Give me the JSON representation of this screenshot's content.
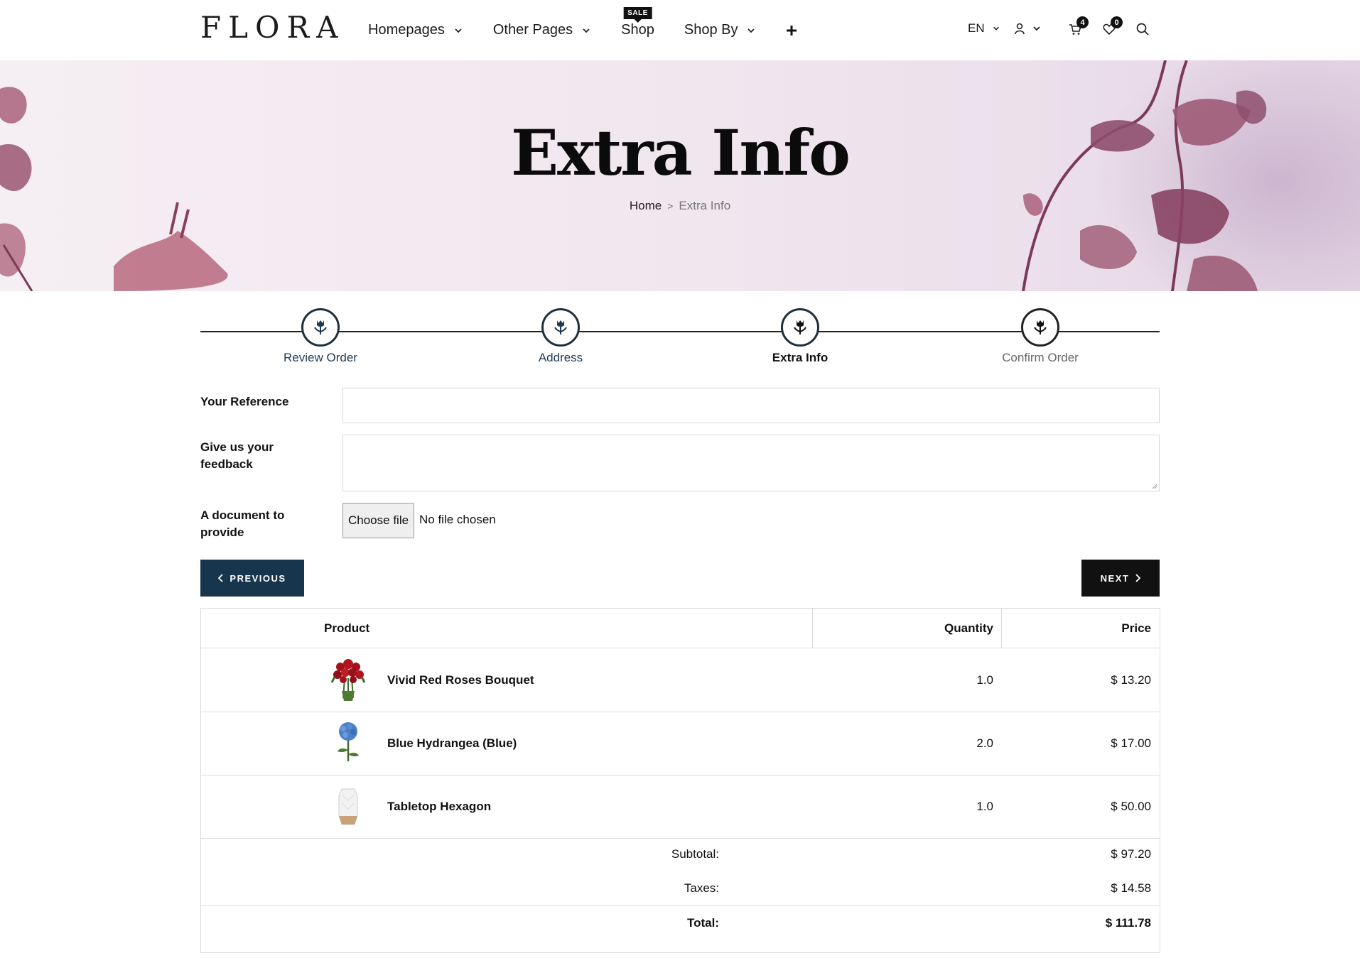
{
  "header": {
    "logo": "FLORA",
    "nav": [
      {
        "label": "Homepages",
        "has_dropdown": true
      },
      {
        "label": "Other Pages",
        "has_dropdown": true
      },
      {
        "label": "Shop",
        "badge": "SALE",
        "has_dropdown": false
      },
      {
        "label": "Shop By",
        "has_dropdown": true
      }
    ],
    "plus_icon": "plus-icon",
    "language": "EN",
    "cart_count": "4",
    "wishlist_count": "0",
    "icons": [
      "user-icon",
      "cart-icon",
      "heart-icon",
      "search-icon"
    ]
  },
  "banner": {
    "title": "Extra Info",
    "breadcrumb": {
      "home": "Home",
      "separator": ">",
      "current": "Extra Info"
    }
  },
  "steps": [
    {
      "label": "Review Order",
      "state": "done",
      "icon": "tulip-icon"
    },
    {
      "label": "Address",
      "state": "done",
      "icon": "tulip-icon"
    },
    {
      "label": "Extra Info",
      "state": "active",
      "icon": "tulip-icon"
    },
    {
      "label": "Confirm Order",
      "state": "future",
      "icon": "tulip-icon"
    }
  ],
  "form": {
    "reference_label": "Your Reference",
    "reference_value": "",
    "feedback_label": "Give us your feedback",
    "feedback_value": "",
    "document_label": "A document to provide",
    "file_button": "Choose file",
    "file_status": "No file chosen"
  },
  "buttons": {
    "previous": "PREVIOUS",
    "next": "NEXT"
  },
  "table": {
    "headers": {
      "product": "Product",
      "quantity": "Quantity",
      "price": "Price"
    },
    "rows": [
      {
        "name": "Vivid Red Roses Bouquet",
        "quantity": "1.0",
        "price": "$ 13.20",
        "image": "red-roses-image"
      },
      {
        "name": "Blue Hydrangea (Blue)",
        "quantity": "2.0",
        "price": "$ 17.00",
        "image": "blue-hydrangea-image"
      },
      {
        "name": "Tabletop Hexagon",
        "quantity": "1.0",
        "price": "$ 50.00",
        "image": "hexagon-vase-image"
      }
    ],
    "subtotal_label": "Subtotal:",
    "subtotal": "$ 97.20",
    "taxes_label": "Taxes:",
    "taxes": "$ 14.58",
    "total_label": "Total:",
    "total": "$ 111.78"
  },
  "colors": {
    "primary_dark": "#17354c",
    "black": "#111111",
    "banner_flower": "#8e4f6c"
  }
}
